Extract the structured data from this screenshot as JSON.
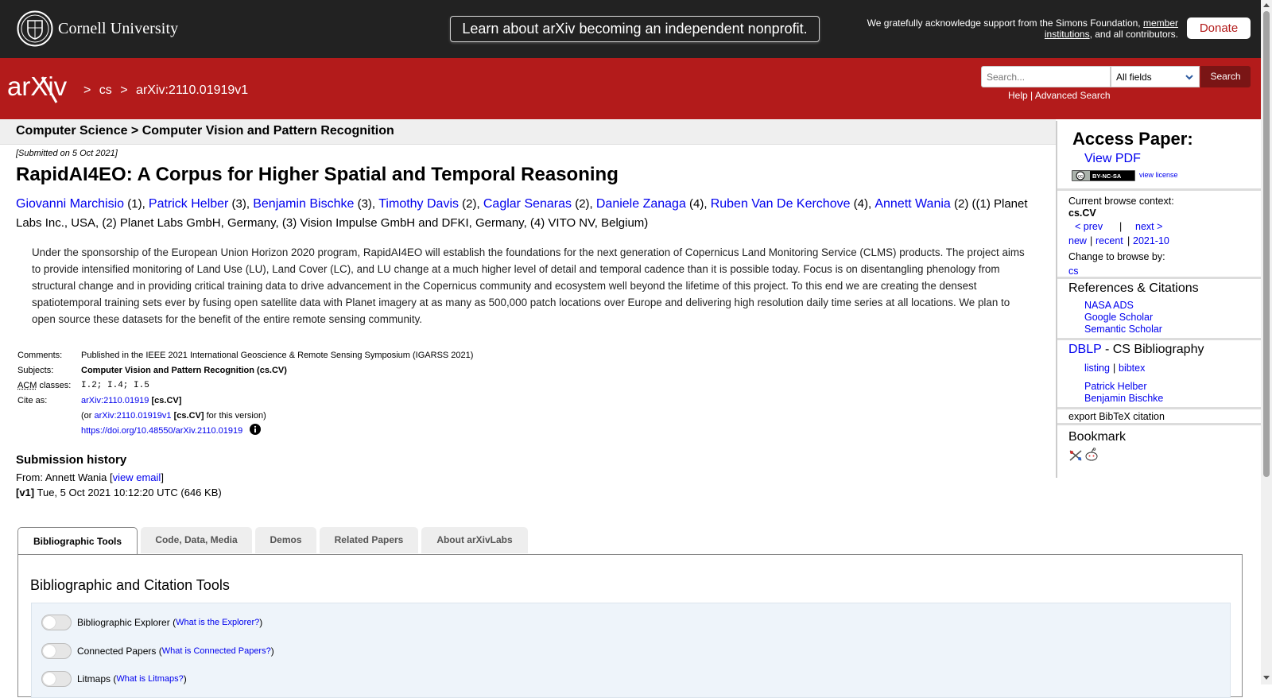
{
  "banner": {
    "cornell_name": "Cornell University",
    "nonprofit_label": "Learn about arXiv becoming an independent nonprofit.",
    "support_prefix": "We gratefully acknowledge support from the Simons Foundation,",
    "support_link": "member institutions",
    "support_suffix": ", and all contributors.",
    "donate_label": "Donate"
  },
  "header": {
    "logo_text": "arXiv",
    "breadcrumb": [
      ">",
      "cs",
      ">",
      "arXiv:2110.01919v1"
    ],
    "search_placeholder": "Search...",
    "search_field": "All fields",
    "search_button": "Search",
    "help_link": "Help",
    "separator": "|",
    "advanced_link": "Advanced Search"
  },
  "subheader": {
    "text": "Computer Science > Computer Vision and Pattern Recognition"
  },
  "paper": {
    "submitted": "[Submitted on 5 Oct 2021]",
    "title": "RapidAI4EO: A Corpus for Higher Spatial and Temporal Reasoning",
    "authors": [
      {
        "name": "Giovanni Marchisio",
        "aff": " (1), "
      },
      {
        "name": "Patrick Helber",
        "aff": " (3), "
      },
      {
        "name": "Benjamin Bischke",
        "aff": " (3), "
      },
      {
        "name": "Timothy Davis",
        "aff": " (2), "
      },
      {
        "name": "Caglar Senaras",
        "aff": " (2), "
      },
      {
        "name": "Daniele Zanaga",
        "aff": " (4), "
      },
      {
        "name": "Ruben Van De Kerchove",
        "aff": " (4), "
      },
      {
        "name": "Annett Wania",
        "aff": " (2) "
      }
    ],
    "affiliations": "((1) Planet Labs Inc., USA, (2) Planet Labs GmbH, Germany, (3) Vision Impulse GmbH and DFKI, Germany, (4) VITO NV, Belgium)",
    "abstract": "Under the sponsorship of the European Union Horizon 2020 program, RapidAI4EO will establish the foundations for the next generation of Copernicus Land Monitoring Service (CLMS) products. The project aims to provide intensified monitoring of Land Use (LU), Land Cover (LC), and LU change at a much higher level of detail and temporal cadence than it is possible today. Focus is on disentangling phenology from structural change and in providing critical training data to drive advancement in the Copernicus community and ecosystem well beyond the lifetime of this project. To this end we are creating the densest spatiotemporal training sets ever by fusing open satellite data with Planet imagery at as many as 500,000 patch locations over Europe and delivering high resolution daily time series at all locations. We plan to open source these datasets for the benefit of the entire remote sensing community."
  },
  "meta": {
    "comments_label": "Comments:",
    "comments": "Published in the IEEE 2021 International Geoscience & Remote Sensing Symposium (IGARSS 2021)",
    "subjects_label": "Subjects:",
    "subjects": "Computer Vision and Pattern Recognition (cs.CV)",
    "acm_abbr": "ACM",
    "acm_label_rest": " classes:",
    "acm": "I.2; I.4; I.5",
    "cite_label": "Cite as:",
    "cite_id": "arXiv:2110.01919",
    "cite_cat": "[cs.CV]",
    "cite_or_prefix": "(or ",
    "cite_version_id": "arXiv:2110.01919v1",
    "cite_version_cat": "[cs.CV]",
    "cite_version_suffix": " for this version)",
    "doi": "https://doi.org/10.48550/arXiv.2110.01919"
  },
  "history": {
    "title": "Submission history",
    "from_prefix": "From: Annett Wania [",
    "view_email": "view email",
    "from_suffix": "]",
    "v1_label": "[v1]",
    "v1_text": " Tue, 5 Oct 2021 10:12:20 UTC (646 KB)"
  },
  "sidebar": {
    "access_title": "Access Paper:",
    "view_pdf": "View PDF",
    "cc_badge": "BY-NC-SA",
    "view_license": "view license",
    "context_label": "Current browse context:",
    "context_value": "cs.CV",
    "prev": "< prev",
    "pipe": "|",
    "next": "next >",
    "new": "new",
    "recent": "recent",
    "month": "2021-10",
    "change_label": "Change to browse by:",
    "browse_cs": "cs",
    "refs_title": "References & Citations",
    "nasa": "NASA ADS",
    "google": "Google Scholar",
    "semantic": "Semantic Scholar",
    "dblp": "DBLP",
    "dblp_suffix": " - CS Bibliography",
    "listing": "listing",
    "bibtex": "bibtex",
    "author1": "Patrick Helber",
    "author2": "Benjamin Bischke",
    "export": "export BibTeX citation",
    "bookmark": "Bookmark"
  },
  "tabs": {
    "items": [
      "Bibliographic Tools",
      "Code, Data, Media",
      "Demos",
      "Related Papers",
      "About arXivLabs"
    ],
    "panel_title": "Bibliographic and Citation Tools",
    "tools": [
      {
        "label": "Bibliographic Explorer",
        "link": "What is the Explorer?"
      },
      {
        "label": "Connected Papers",
        "link": "What is Connected Papers?"
      },
      {
        "label": "Litmaps",
        "link": "What is Litmaps?"
      }
    ]
  },
  "colors": {
    "arxiv_red": "#b31b1b",
    "banner": "#222222",
    "link": "#0000ee"
  }
}
